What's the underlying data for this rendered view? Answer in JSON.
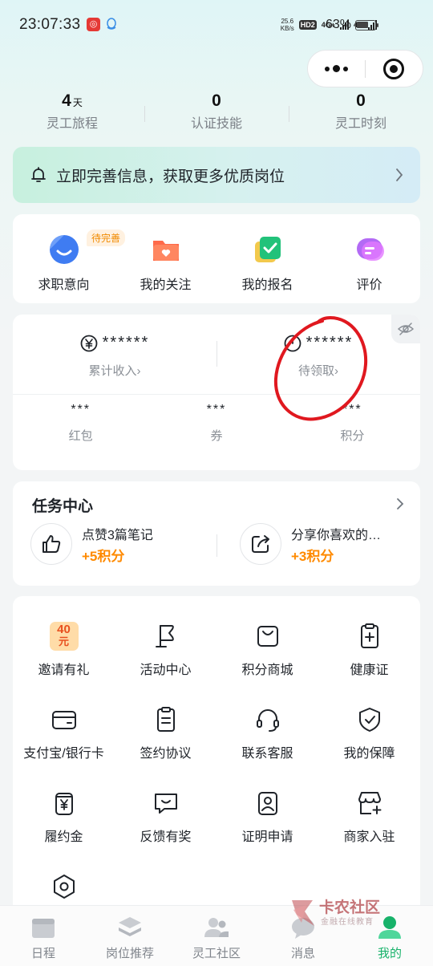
{
  "status_bar": {
    "time": "23:07:33",
    "net_speed_top": "25.6",
    "net_speed_bottom": "KB/s",
    "hd_label": "HD2",
    "signal1_label": "4G+",
    "signal2_label": "4G",
    "battery": "63%"
  },
  "stats": [
    {
      "value": "4",
      "unit": "天",
      "label": "灵工旅程"
    },
    {
      "value": "0",
      "unit": "",
      "label": "认证技能"
    },
    {
      "value": "0",
      "unit": "",
      "label": "灵工时刻"
    }
  ],
  "banner": {
    "text": "立即完善信息，获取更多优质岗位"
  },
  "quick_actions": {
    "badge": "待完善",
    "items": [
      {
        "label": "求职意向",
        "icon": "job-intention-icon"
      },
      {
        "label": "我的关注",
        "icon": "favorites-folder-icon"
      },
      {
        "label": "我的报名",
        "icon": "signup-check-icon"
      },
      {
        "label": "评价",
        "icon": "review-chat-icon"
      }
    ]
  },
  "wallet": {
    "income_value": "******",
    "income_label": "累计收入",
    "pending_value": "******",
    "pending_label": "待领取",
    "small": [
      {
        "value": "***",
        "label": "红包"
      },
      {
        "value": "***",
        "label": "券"
      },
      {
        "value": "***",
        "label": "积分"
      }
    ]
  },
  "tasks": {
    "title": "任务中心",
    "items": [
      {
        "name": "点赞3篇笔记",
        "points": "+5积分"
      },
      {
        "name": "分享你喜欢的…",
        "points": "+3积分"
      }
    ]
  },
  "services": {
    "badge_text": "40",
    "badge_sub": "元",
    "items": [
      {
        "label": "邀请有礼"
      },
      {
        "label": "活动中心"
      },
      {
        "label": "积分商城"
      },
      {
        "label": "健康证"
      },
      {
        "label": "支付宝/银行卡"
      },
      {
        "label": "签约协议"
      },
      {
        "label": "联系客服"
      },
      {
        "label": "我的保障"
      },
      {
        "label": "履约金"
      },
      {
        "label": "反馈有奖"
      },
      {
        "label": "证明申请"
      },
      {
        "label": "商家入驻"
      },
      {
        "label": ""
      }
    ]
  },
  "tabbar": [
    {
      "label": "日程"
    },
    {
      "label": "岗位推荐"
    },
    {
      "label": "灵工社区"
    },
    {
      "label": "消息"
    },
    {
      "label": "我的"
    }
  ],
  "watermark": {
    "title": "卡农社区",
    "subtitle": "金融在线教育"
  },
  "colors": {
    "accent": "#17b26a",
    "points": "#ff8a00",
    "annotation": "#e0181f"
  }
}
